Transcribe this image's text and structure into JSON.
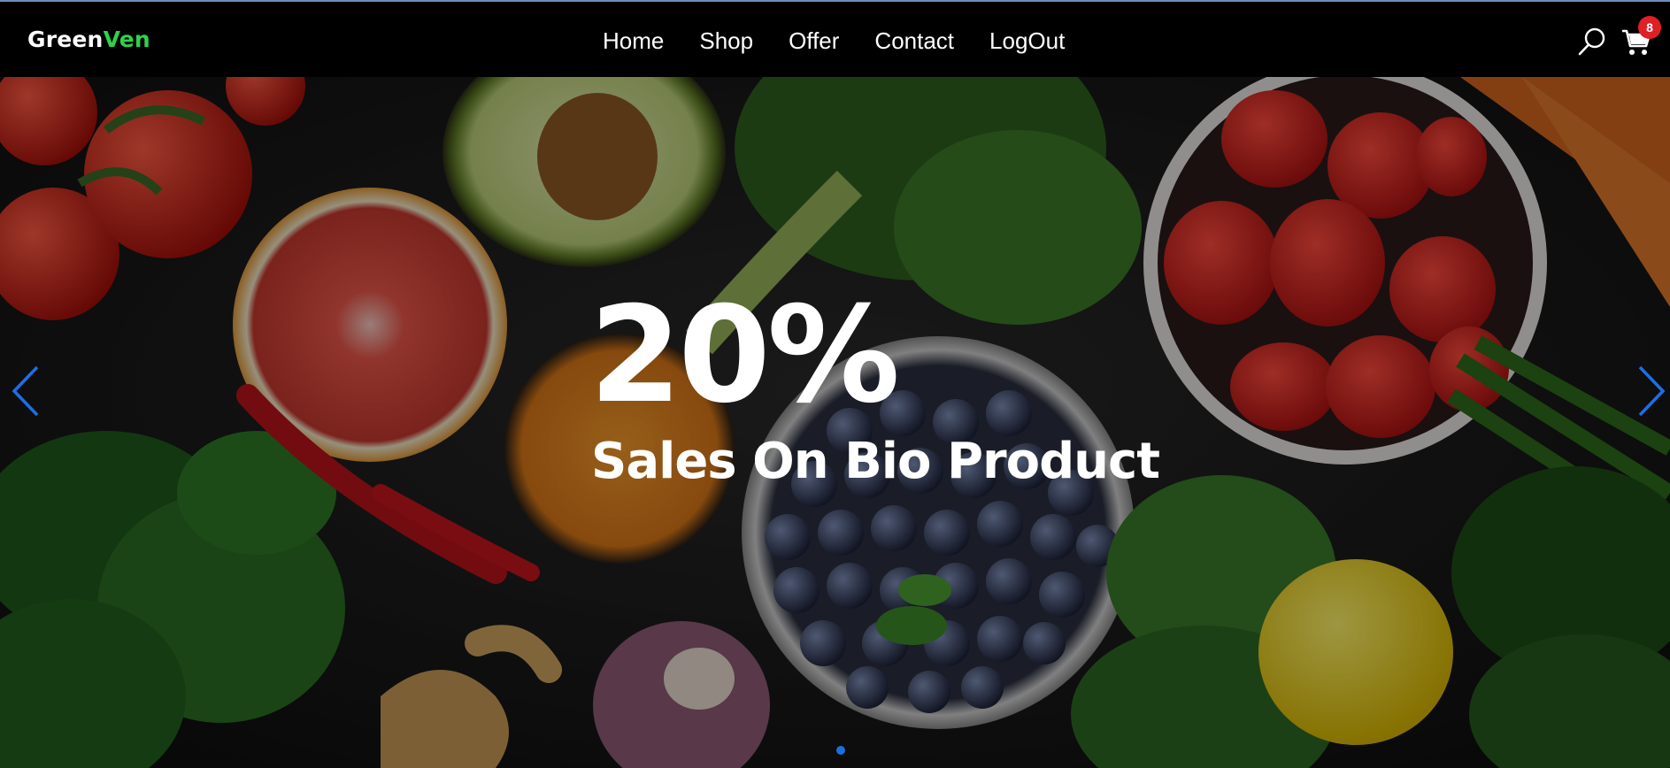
{
  "brand": {
    "part1": "Green",
    "part2": "Ven"
  },
  "nav": {
    "items": [
      "Home",
      "Shop",
      "Offer",
      "Contact",
      "LogOut"
    ]
  },
  "header": {
    "search_icon": "search-icon",
    "cart_icon": "cart-icon",
    "cart_count": "8"
  },
  "hero": {
    "headline": "20%",
    "subline": "Sales On Bio Product",
    "active_slide": 1
  },
  "colors": {
    "brand_green": "#2fd14a",
    "badge_red": "#e01f26",
    "accent_blue": "#1a6fe0",
    "header_bg": "#000000"
  }
}
